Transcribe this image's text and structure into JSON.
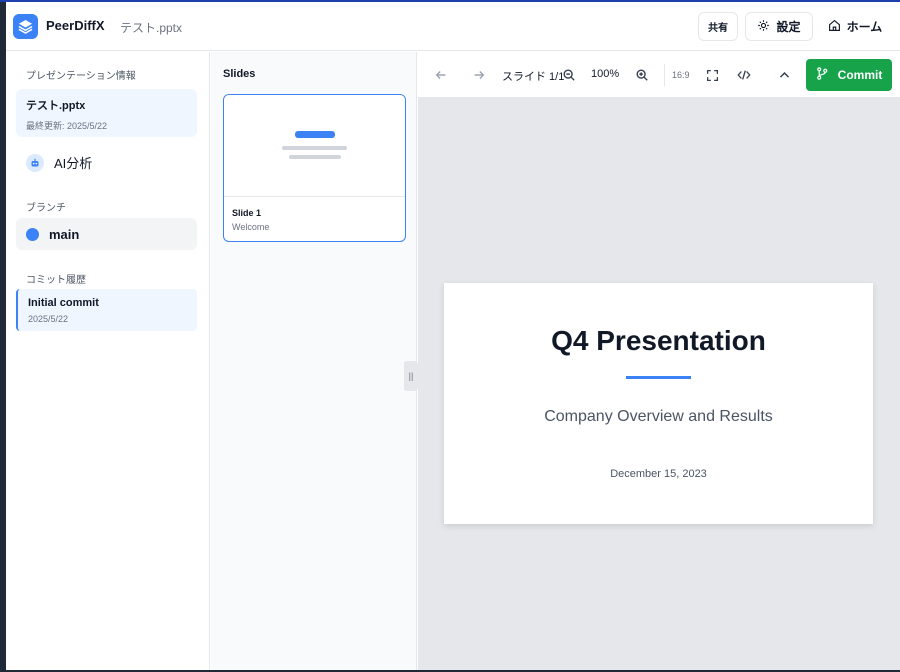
{
  "header": {
    "app_name": "PeerDiffX",
    "file_name": "テスト.pptx",
    "share_label": "共有",
    "settings_label": "設定",
    "home_label": "ホーム"
  },
  "sidebar": {
    "info_section_label": "プレゼンテーション情報",
    "presentation_title": "テスト.pptx",
    "last_updated": "最終更新: 2025/5/22",
    "ai_label": "AI分析",
    "branch_section_label": "ブランチ",
    "branch_name": "main",
    "history_section_label": "コミット履歴",
    "commit_title": "Initial commit",
    "commit_date": "2025/5/22"
  },
  "slides_panel": {
    "title": "Slides",
    "items": [
      {
        "title": "Slide 1",
        "subtitle": "Welcome"
      }
    ]
  },
  "toolbar": {
    "slide_counter": "スライド 1/1",
    "zoom": "100%",
    "aspect": "16:9",
    "commit_label": "Commit"
  },
  "slide": {
    "title": "Q4 Presentation",
    "subtitle": "Company Overview and Results",
    "date": "December 15, 2023"
  },
  "colors": {
    "accent": "#3b82f6",
    "commit": "#16a34a"
  },
  "icons": [
    "layers-icon",
    "gear-icon",
    "home-icon",
    "robot-icon",
    "arrow-left-icon",
    "arrow-right-icon",
    "zoom-out-icon",
    "zoom-in-icon",
    "fullscreen-icon",
    "code-icon",
    "chevron-up-icon",
    "git-branch-icon"
  ]
}
